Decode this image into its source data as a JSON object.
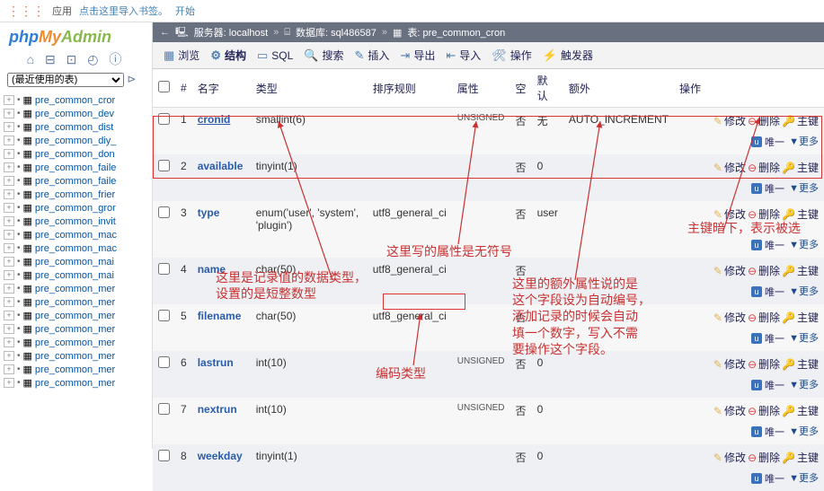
{
  "topbar": {
    "apps": "应用",
    "hint": "点击这里导入书签。",
    "start": "开始"
  },
  "logo": {
    "a": "php",
    "b": "My",
    "c": "Admin"
  },
  "recent_label": "(最近使用的表)",
  "tree": [
    "pre_common_cror",
    "pre_common_dev",
    "pre_common_dist",
    "pre_common_diy_",
    "pre_common_don",
    "pre_common_faile",
    "pre_common_faile",
    "pre_common_frier",
    "pre_common_gror",
    "pre_common_invit",
    "pre_common_mac",
    "pre_common_mac",
    "pre_common_mai",
    "pre_common_mai",
    "pre_common_mer",
    "pre_common_mer",
    "pre_common_mer",
    "pre_common_mer",
    "pre_common_mer",
    "pre_common_mer",
    "pre_common_mer",
    "pre_common_mer"
  ],
  "breadcrumb": {
    "server": "服务器: localhost",
    "db": "数据库: sql486587",
    "table": "表: pre_common_cron"
  },
  "tabs": {
    "browse": "浏览",
    "structure": "结构",
    "sql": "SQL",
    "search": "搜索",
    "insert": "插入",
    "export": "导出",
    "import": "导入",
    "ops": "操作",
    "trigger": "触发器"
  },
  "headers": {
    "num": "#",
    "name": "名字",
    "type": "类型",
    "collation": "排序规则",
    "attr": "属性",
    "null": "空",
    "default": "默认",
    "extra": "额外",
    "ops": "操作"
  },
  "op_labels": {
    "edit": "修改",
    "drop": "删除",
    "primary": "主键",
    "unique": "唯一",
    "more": "更多"
  },
  "null_no": "否",
  "rows": [
    {
      "n": 1,
      "name": "cronid",
      "type": "smallint(6)",
      "collation": "",
      "attr": "UNSIGNED",
      "def": "无",
      "extra": "AUTO_INCREMENT",
      "pk": true
    },
    {
      "n": 2,
      "name": "available",
      "type": "tinyint(1)",
      "collation": "",
      "attr": "",
      "def": "0",
      "extra": "",
      "pk": false
    },
    {
      "n": 3,
      "name": "type",
      "type": "enum('user', 'system', 'plugin')",
      "collation": "utf8_general_ci",
      "attr": "",
      "def": "user",
      "extra": "",
      "pk": false
    },
    {
      "n": 4,
      "name": "name",
      "type": "char(50)",
      "collation": "utf8_general_ci",
      "attr": "",
      "def": "",
      "extra": "",
      "pk": false
    },
    {
      "n": 5,
      "name": "filename",
      "type": "char(50)",
      "collation": "utf8_general_ci",
      "attr": "",
      "def": "",
      "extra": "",
      "pk": false
    },
    {
      "n": 6,
      "name": "lastrun",
      "type": "int(10)",
      "collation": "",
      "attr": "UNSIGNED",
      "def": "0",
      "extra": "",
      "pk": false
    },
    {
      "n": 7,
      "name": "nextrun",
      "type": "int(10)",
      "collation": "",
      "attr": "UNSIGNED",
      "def": "0",
      "extra": "",
      "pk": false
    },
    {
      "n": 8,
      "name": "weekday",
      "type": "tinyint(1)",
      "collation": "",
      "attr": "",
      "def": "0",
      "extra": "",
      "pk": false
    }
  ],
  "annotations": {
    "a1": "这里是记录值的数据类型，\n设置的是短整数型",
    "a2": "编码类型",
    "a3": "这里写的属性是无符号",
    "a4": "这里的额外属性说的是\n这个字段设为自动编号，\n添加记录的时候会自动\n填一个数字，写入不需\n要操作这个字段。",
    "a5": "主键暗下，表示被选"
  }
}
